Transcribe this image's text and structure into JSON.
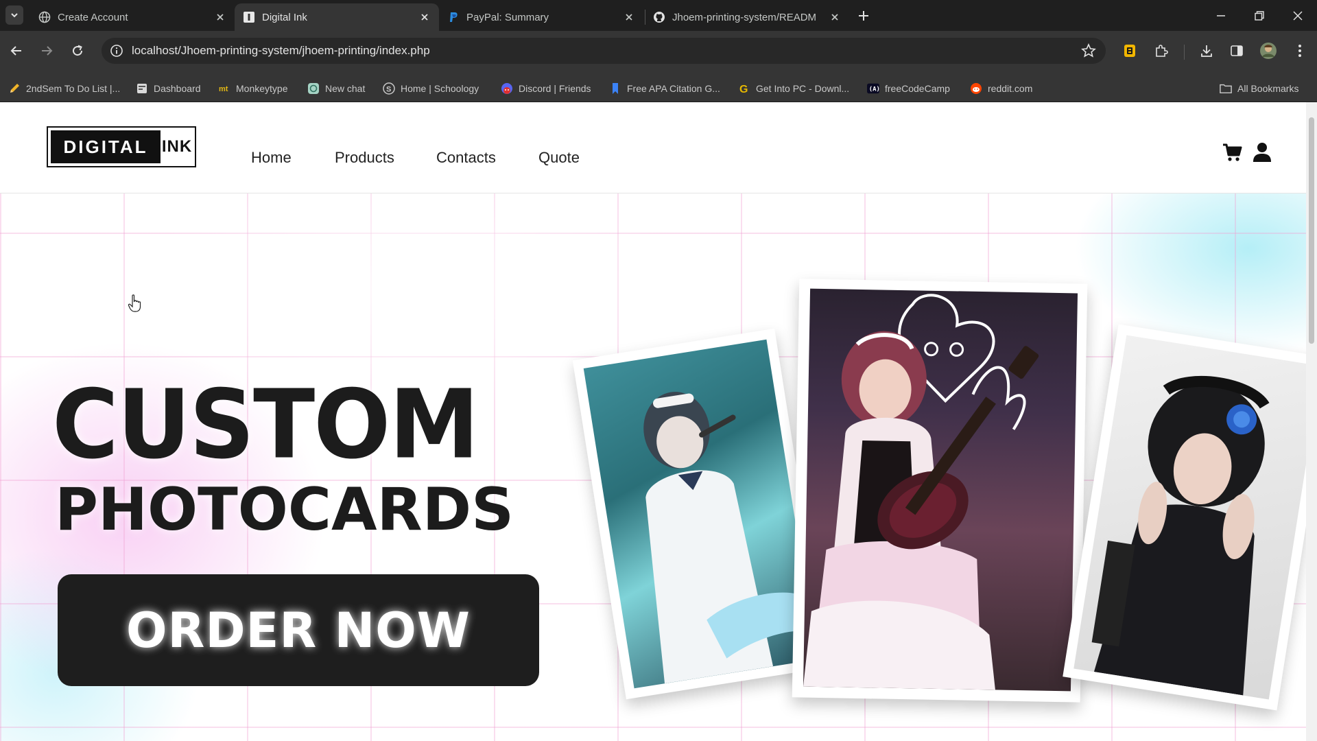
{
  "browser": {
    "tabs": [
      {
        "title": "Create Account",
        "icon": "globe-icon",
        "active": false
      },
      {
        "title": "Digital Ink",
        "icon": "page-icon",
        "active": true
      },
      {
        "title": "PayPal: Summary",
        "icon": "paypal-icon",
        "active": false
      },
      {
        "title": "Jhoem-printing-system/READM",
        "icon": "github-icon",
        "active": false
      }
    ],
    "url": "localhost/Jhoem-printing-system/jhoem-printing/index.php",
    "bookmarks": [
      {
        "label": "2ndSem To Do List |...",
        "icon": "pencil-icon"
      },
      {
        "label": "Dashboard",
        "icon": "dashboard-icon"
      },
      {
        "label": "Monkeytype",
        "icon": "monkeytype-icon"
      },
      {
        "label": "New chat",
        "icon": "chat-icon"
      },
      {
        "label": "Home | Schoology",
        "icon": "schoology-icon"
      },
      {
        "label": "Discord | Friends",
        "icon": "discord-icon"
      },
      {
        "label": "Free APA Citation G...",
        "icon": "bookmark-icon"
      },
      {
        "label": "Get Into PC - Downl...",
        "icon": "g-icon"
      },
      {
        "label": "freeCodeCamp",
        "icon": "freecodecamp-icon"
      },
      {
        "label": "reddit.com",
        "icon": "reddit-icon"
      }
    ],
    "all_bookmarks": "All Bookmarks"
  },
  "site": {
    "logo_left": "DIGITAL",
    "logo_right": "INK",
    "nav": [
      "Home",
      "Products",
      "Contacts",
      "Quote"
    ]
  },
  "hero": {
    "headline_line1": "CUSTOM",
    "headline_line2": "PHOTOCARDS",
    "cta": "ORDER NOW"
  },
  "colors": {
    "chrome_dark": "#1f1f1f",
    "chrome_toolbar": "#353535",
    "text_dark": "#1c1c1c",
    "hero_pink": "#f3aaeb",
    "hero_cyan": "#78e1f0"
  }
}
